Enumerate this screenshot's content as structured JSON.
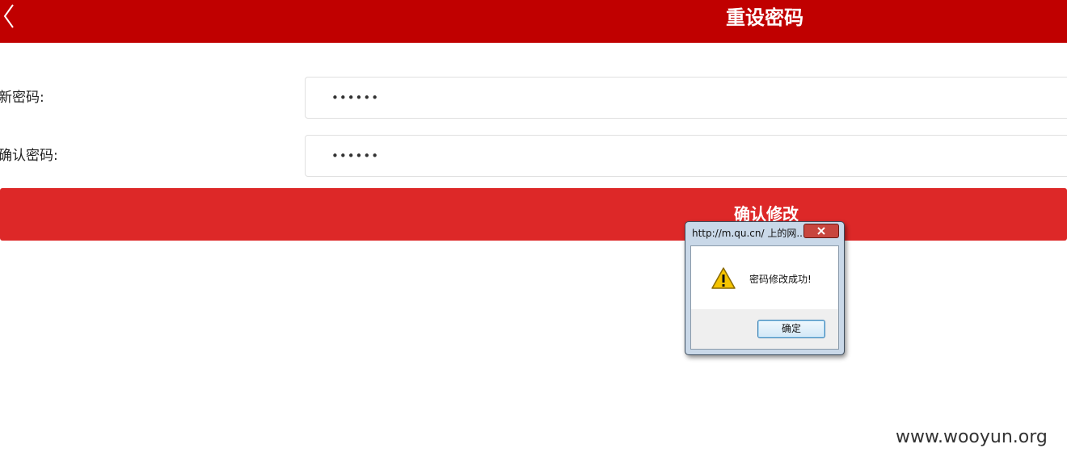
{
  "header": {
    "back_icon": "chevron-left-icon",
    "title": "重设密码"
  },
  "form": {
    "new_password_label": "新密码:",
    "new_password_value": "••••••",
    "confirm_password_label": "确认密码:",
    "confirm_password_value": "••••••",
    "submit_label": "确认修改"
  },
  "dialog": {
    "title": "http://m.qu.cn/ 上的网...",
    "close_icon": "close-icon",
    "warning_icon": "warning-icon",
    "message": "密码修改成功!",
    "ok_label": "确定"
  },
  "watermark": "www.wooyun.org",
  "colors": {
    "header_bg": "#c00000",
    "button_bg": "#dd2828"
  }
}
